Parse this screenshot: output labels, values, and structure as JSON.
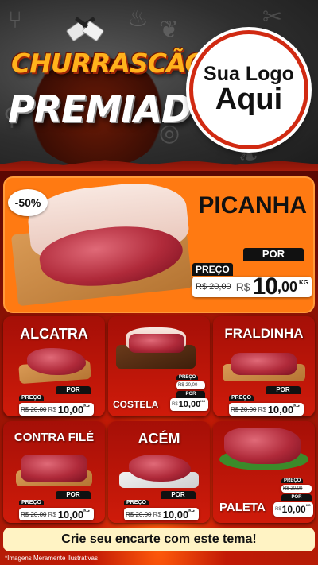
{
  "header": {
    "title_line1": "CHURRASCÃO",
    "title_line2": "PREMIADO",
    "logo_line1": "Sua Logo",
    "logo_line2": "Aqui"
  },
  "hero": {
    "name": "PICANHA",
    "discount": "-50%",
    "price_label": "PREÇO",
    "por_label": "POR",
    "old_price": "R$ 20,00",
    "currency": "R$",
    "price_int": "10",
    "price_dec": ",00",
    "unit": "KG"
  },
  "products": [
    {
      "name": "ALCATRA",
      "price_label": "PREÇO",
      "por_label": "POR",
      "old_price": "R$ 20,00",
      "currency": "R$",
      "price": "10,00",
      "unit": "KG"
    },
    {
      "name": "COSTELA",
      "price_label": "PREÇO",
      "por_label": "POR",
      "old_price": "R$ 20,00",
      "currency": "R$",
      "price": "10,00",
      "unit": "KG"
    },
    {
      "name": "FRALDINHA",
      "price_label": "PREÇO",
      "por_label": "POR",
      "old_price": "R$ 20,00",
      "currency": "R$",
      "price": "10,00",
      "unit": "KG"
    },
    {
      "name": "CONTRA FILÉ",
      "price_label": "PREÇO",
      "por_label": "POR",
      "old_price": "R$ 20,00",
      "currency": "R$",
      "price": "10,00",
      "unit": "KG"
    },
    {
      "name": "ACÉM",
      "price_label": "PREÇO",
      "por_label": "POR",
      "old_price": "R$ 20,00",
      "currency": "R$",
      "price": "10,00",
      "unit": "KG"
    },
    {
      "name": "PALETA",
      "price_label": "PREÇO",
      "por_label": "POR",
      "old_price": "R$ 20,00",
      "currency": "R$",
      "price": "10,00",
      "unit": "KG"
    }
  ],
  "footer": {
    "cta": "Crie seu encarte com este tema!",
    "disclaimer": "*Imagens Meramente Ilustrativas"
  },
  "colors": {
    "hero_bg": "#ff7a12",
    "card_bg": "#c8150a",
    "title_orange": "#ffb21c"
  }
}
